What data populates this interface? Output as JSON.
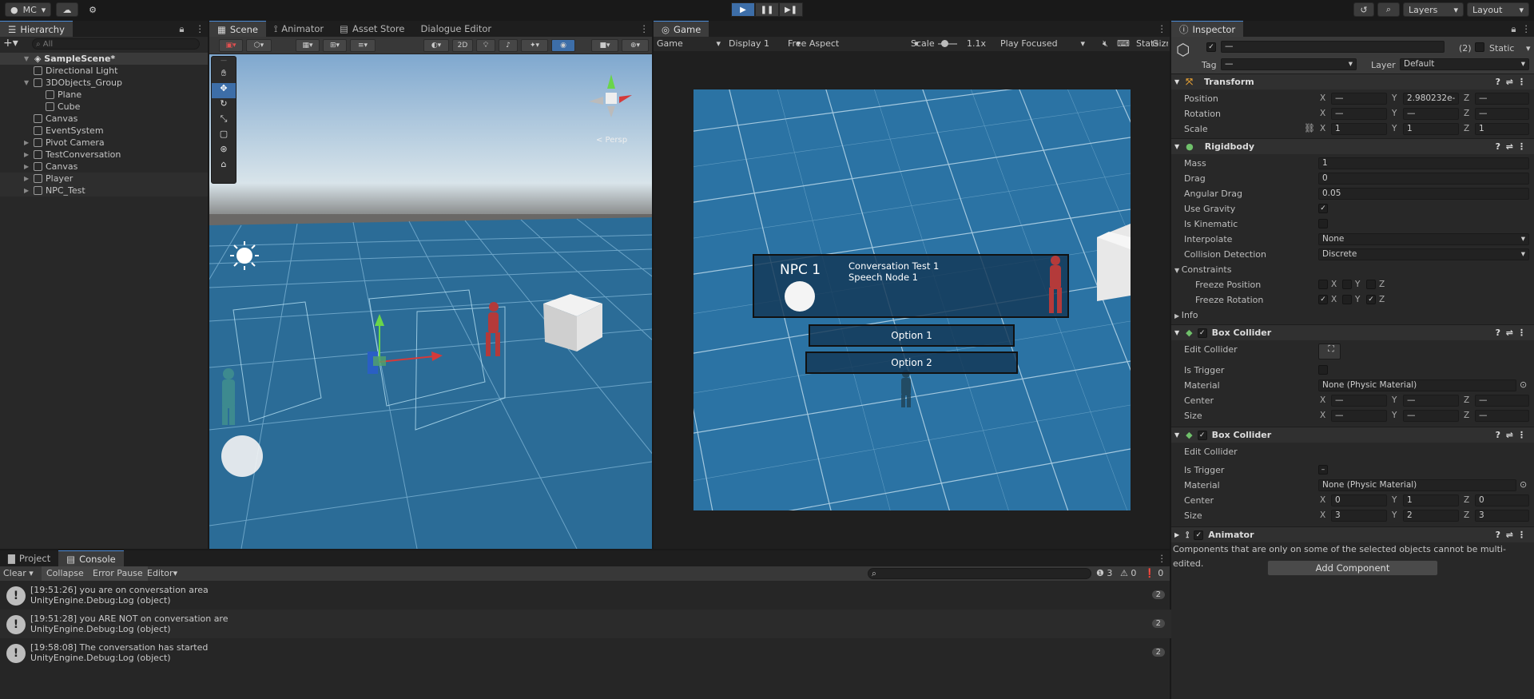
{
  "toolbar": {
    "account": "MC",
    "layers": "Layers",
    "layout": "Layout"
  },
  "hierarchy": {
    "tab": "Hierarchy",
    "search_placeholder": "All",
    "scene": "SampleScene*",
    "items": [
      {
        "label": "Directional Light",
        "indent": 2,
        "arrow": ""
      },
      {
        "label": "3DObjects_Group",
        "indent": 2,
        "arrow": "▼"
      },
      {
        "label": "Plane",
        "indent": 3,
        "arrow": ""
      },
      {
        "label": "Cube",
        "indent": 3,
        "arrow": ""
      },
      {
        "label": "Canvas",
        "indent": 2,
        "arrow": ""
      },
      {
        "label": "EventSystem",
        "indent": 2,
        "arrow": ""
      },
      {
        "label": "Pivot Camera",
        "indent": 2,
        "arrow": "▶"
      },
      {
        "label": "TestConversation",
        "indent": 2,
        "arrow": "▶"
      },
      {
        "label": "Canvas",
        "indent": 2,
        "arrow": "▶"
      },
      {
        "label": "Player",
        "indent": 2,
        "arrow": "▶"
      },
      {
        "label": "NPC_Test",
        "indent": 2,
        "arrow": "▶"
      }
    ]
  },
  "scene_tabs": [
    "Scene",
    "Animator",
    "Asset Store",
    "Dialogue Editor"
  ],
  "scene_toolbar": {
    "mode2d": "2D",
    "persp": "< Persp"
  },
  "game": {
    "tab": "Game",
    "display_mode": "Game",
    "display": "Display 1",
    "aspect": "Free Aspect",
    "scale_label": "Scale",
    "scale_value": "1.1x",
    "play_mode": "Play Focused",
    "stats": "Stats",
    "gizmos": "Gizm",
    "dialogue": {
      "speaker": "NPC 1",
      "line1": "Conversation Test 1",
      "line2": "Speech Node 1",
      "option1": "Option 1",
      "option2": "Option 2"
    }
  },
  "inspector": {
    "tab": "Inspector",
    "name": "—",
    "count": "(2)",
    "static": "Static",
    "tag_label": "Tag",
    "tag_value": "—",
    "layer_label": "Layer",
    "layer_value": "Default",
    "transform": {
      "title": "Transform",
      "rows": [
        {
          "label": "Position",
          "x": "—",
          "y": "2.980232e-",
          "z": "—"
        },
        {
          "label": "Rotation",
          "x": "—",
          "y": "—",
          "z": "—"
        },
        {
          "label": "Scale",
          "x": "1",
          "y": "1",
          "z": "1"
        }
      ]
    },
    "rigidbody": {
      "title": "Rigidbody",
      "mass_label": "Mass",
      "mass": "1",
      "drag_label": "Drag",
      "drag": "0",
      "angular_label": "Angular Drag",
      "angular": "0.05",
      "gravity_label": "Use Gravity",
      "kinematic_label": "Is Kinematic",
      "interp_label": "Interpolate",
      "interp": "None",
      "collision_label": "Collision Detection",
      "collision": "Discrete",
      "constraints_label": "Constraints",
      "freeze_pos_label": "Freeze Position",
      "freeze_rot_label": "Freeze Rotation",
      "info_label": "Info"
    },
    "box1": {
      "title": "Box Collider",
      "edit_label": "Edit Collider",
      "trigger_label": "Is Trigger",
      "material_label": "Material",
      "material": "None (Physic Material)",
      "center_label": "Center",
      "cx": "—",
      "cy": "—",
      "cz": "—",
      "size_label": "Size",
      "sx": "—",
      "sy": "—",
      "sz": "—"
    },
    "box2": {
      "title": "Box Collider",
      "edit_label": "Edit Collider",
      "trigger_label": "Is Trigger",
      "material_label": "Material",
      "material": "None (Physic Material)",
      "center_label": "Center",
      "cx": "0",
      "cy": "1",
      "cz": "0",
      "size_label": "Size",
      "sx": "3",
      "sy": "2",
      "sz": "3"
    },
    "animator": {
      "title": "Animator"
    },
    "multi_note": "Components that are only on some of the selected objects cannot be multi-edited.",
    "add_component": "Add Component"
  },
  "console": {
    "tab_project": "Project",
    "tab_console": "Console",
    "clear": "Clear",
    "collapse": "Collapse",
    "error_pause": "Error Pause",
    "editor": "Editor",
    "count_info": "3",
    "count_warn": "0",
    "count_err": "0",
    "logs": [
      {
        "line1": "[19:51:26] you are on conversation area",
        "line2": "UnityEngine.Debug:Log (object)",
        "count": "2"
      },
      {
        "line1": "[19:51:28] you ARE NOT on conversation are",
        "line2": "UnityEngine.Debug:Log (object)",
        "count": "2"
      },
      {
        "line1": "[19:58:08] The conversation has started",
        "line2": "UnityEngine.Debug:Log (object)",
        "count": "2"
      }
    ]
  },
  "colors": {
    "accent": "#3d6ea8",
    "sky": "#b8d4e8",
    "water": "#2a6e9c"
  }
}
